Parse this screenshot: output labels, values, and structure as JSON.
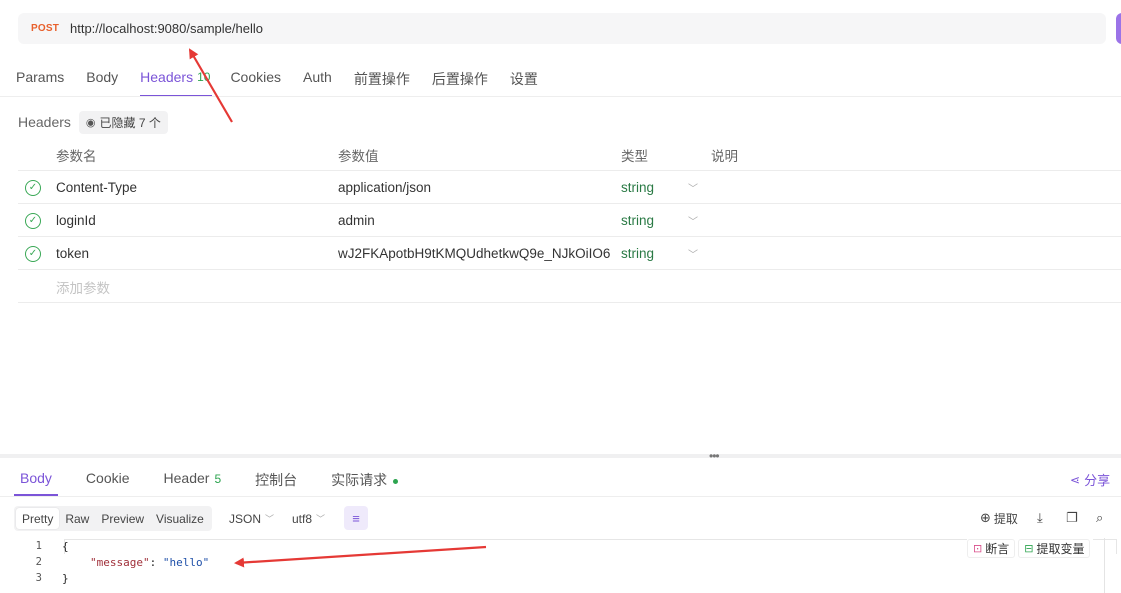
{
  "request": {
    "method": "POST",
    "url": "http://localhost:9080/sample/hello"
  },
  "tabs": [
    {
      "label": "Params"
    },
    {
      "label": "Body"
    },
    {
      "label": "Headers",
      "count": "10"
    },
    {
      "label": "Cookies"
    },
    {
      "label": "Auth"
    },
    {
      "label": "前置操作"
    },
    {
      "label": "后置操作"
    },
    {
      "label": "设置"
    }
  ],
  "headers_section": {
    "label": "Headers",
    "hidden_label": "已隐藏 7 个"
  },
  "table": {
    "columns": [
      "参数名",
      "参数值",
      "类型",
      "说明"
    ],
    "rows": [
      {
        "name": "Content-Type",
        "value": "application/json",
        "type": "string"
      },
      {
        "name": "loginId",
        "value": "admin",
        "type": "string"
      },
      {
        "name": "token",
        "value": "wJ2FKApotbH9tKMQUdhetkwQ9e_NJkOiIO6",
        "type": "string"
      }
    ],
    "add_placeholder": "添加参数"
  },
  "response_tabs": [
    {
      "label": "Body"
    },
    {
      "label": "Cookie"
    },
    {
      "label": "Header",
      "count": "5"
    },
    {
      "label": "控制台"
    },
    {
      "label": "实际请求"
    }
  ],
  "share_label": "分享",
  "format_buttons": [
    "Pretty",
    "Raw",
    "Preview",
    "Visualize"
  ],
  "format_dropdown": "JSON",
  "encoding_dropdown": "utf8",
  "tools": {
    "extract": "提取"
  },
  "code_actions": {
    "assert": "断言",
    "extract_var": "提取变量"
  },
  "code": {
    "line_numbers": [
      "1",
      "2",
      "3"
    ],
    "open_brace": "{",
    "key": "\"message\"",
    "colon": ": ",
    "value": "\"hello\"",
    "close_brace": "}"
  },
  "colors": {
    "accent": "#7b54d8",
    "method_post": "#e8602c",
    "success": "#2ca44f",
    "annotation_arrow": "#e53935"
  },
  "icons": [
    "check-circle-icon",
    "chevron-down-icon",
    "eye-icon",
    "share-icon",
    "wrap-icon",
    "extract-icon",
    "download-icon",
    "copy-icon",
    "search-icon",
    "assert-icon",
    "variable-icon"
  ]
}
